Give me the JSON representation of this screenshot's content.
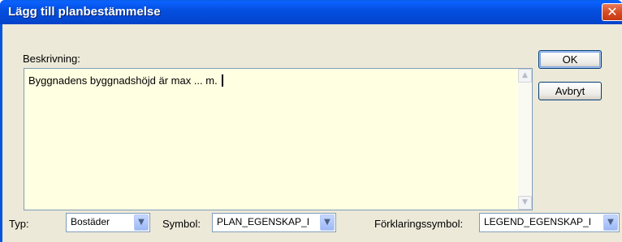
{
  "dialog": {
    "title": "Lägg till planbestämmelse",
    "close_glyph": "✕"
  },
  "description": {
    "label": "Beskrivning:",
    "value": "Byggnadens byggnadshöjd är max ... m."
  },
  "buttons": {
    "ok": "OK",
    "cancel": "Avbryt"
  },
  "fields": {
    "type_label": "Typ:",
    "type_value": "Bostäder",
    "symbol_label": "Symbol:",
    "symbol_value": "PLAN_EGENSKAP_I",
    "legend_label": "Förklaringssymbol:",
    "legend_value": "LEGEND_EGENSKAP_I"
  },
  "icons": {
    "close": "close-icon",
    "dropdown": "chevron-down-icon",
    "scroll_up": "scroll-up-icon",
    "scroll_down": "scroll-down-icon"
  },
  "colors": {
    "titlebar": "#0450e0",
    "dialog_bg": "#ece9d8",
    "memo_bg": "#ffffe1",
    "close": "#d64a22"
  }
}
